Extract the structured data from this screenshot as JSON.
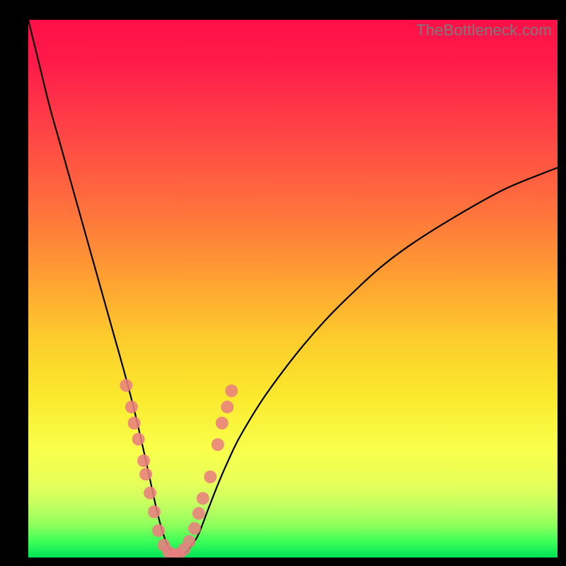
{
  "watermark": "TheBottleneck.com",
  "colors": {
    "background_frame": "#000000",
    "gradient_top": "#ff1048",
    "gradient_bottom": "#00e356",
    "curve_stroke": "#000000",
    "marker_fill": "#e98080"
  },
  "chart_data": {
    "type": "line",
    "title": "",
    "xlabel": "",
    "ylabel": "",
    "xlim": [
      0,
      100
    ],
    "ylim": [
      0,
      100
    ],
    "series": [
      {
        "name": "bottleneck-curve",
        "x": [
          0,
          2,
          4,
          6,
          8,
          10,
          12,
          14,
          16,
          18,
          20,
          22,
          23,
          24,
          25,
          26,
          27,
          28,
          29,
          30,
          32,
          34,
          36,
          38,
          40,
          44,
          48,
          52,
          56,
          60,
          66,
          72,
          80,
          90,
          100
        ],
        "values": [
          100,
          92,
          84,
          77,
          70,
          63,
          56,
          49,
          42,
          35,
          27.5,
          19,
          14.5,
          10,
          6,
          3,
          1.2,
          0.4,
          0.4,
          1.2,
          4,
          9,
          14,
          18.5,
          22.5,
          29,
          34.5,
          39.5,
          44,
          48,
          53.5,
          58,
          63,
          68.5,
          72.5
        ]
      }
    ],
    "markers": {
      "name": "highlighted-points",
      "points": [
        {
          "x": 18.5,
          "y": 32
        },
        {
          "x": 19.5,
          "y": 28
        },
        {
          "x": 20,
          "y": 25
        },
        {
          "x": 20.8,
          "y": 22
        },
        {
          "x": 21.8,
          "y": 18
        },
        {
          "x": 22.2,
          "y": 15.5
        },
        {
          "x": 23,
          "y": 12
        },
        {
          "x": 23.8,
          "y": 8.5
        },
        {
          "x": 24.6,
          "y": 5
        },
        {
          "x": 25.6,
          "y": 2.3
        },
        {
          "x": 26.5,
          "y": 1.0
        },
        {
          "x": 27.5,
          "y": 0.5
        },
        {
          "x": 28.4,
          "y": 0.6
        },
        {
          "x": 29.4,
          "y": 1.5
        },
        {
          "x": 30.4,
          "y": 3.0
        },
        {
          "x": 31.4,
          "y": 5.4
        },
        {
          "x": 32.2,
          "y": 8.2
        },
        {
          "x": 33,
          "y": 11
        },
        {
          "x": 34.4,
          "y": 15
        },
        {
          "x": 35.8,
          "y": 21
        },
        {
          "x": 36.6,
          "y": 25
        },
        {
          "x": 37.6,
          "y": 28
        },
        {
          "x": 38.4,
          "y": 31
        }
      ]
    }
  }
}
